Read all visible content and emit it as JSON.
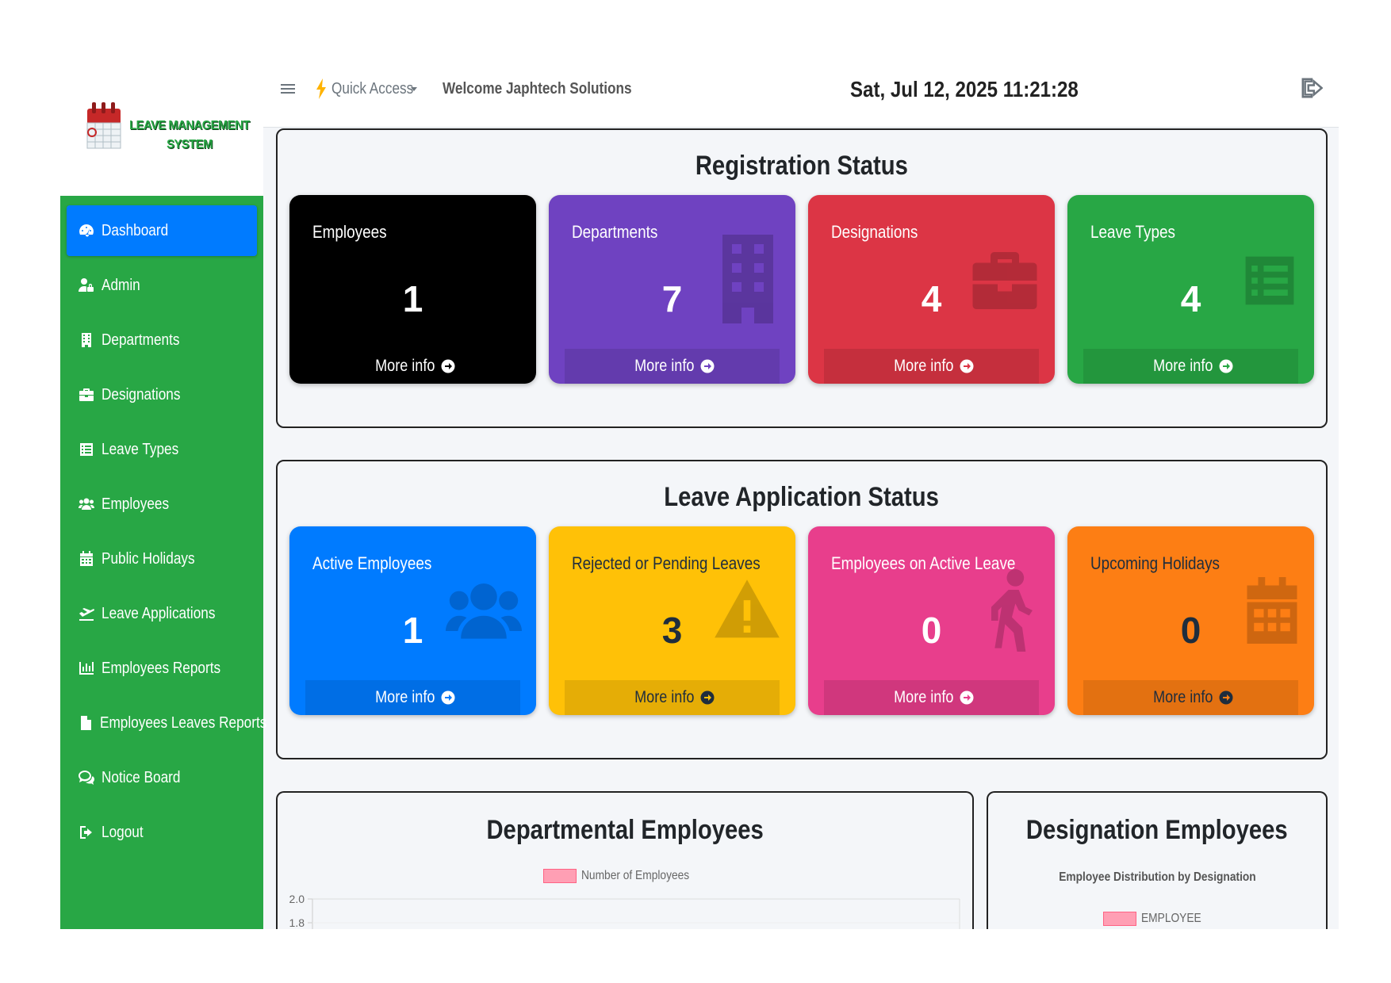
{
  "brand": {
    "line1": "LEAVE MANAGEMENT",
    "line2": "SYSTEM"
  },
  "sidebar": {
    "items": [
      {
        "label": "Dashboard",
        "icon": "tachometer-icon",
        "active": true
      },
      {
        "label": "Admin",
        "icon": "user-lock-icon"
      },
      {
        "label": "Departments",
        "icon": "building-icon"
      },
      {
        "label": "Designations",
        "icon": "briefcase-icon"
      },
      {
        "label": "Leave Types",
        "icon": "list-icon"
      },
      {
        "label": "Employees",
        "icon": "users-icon"
      },
      {
        "label": "Public Holidays",
        "icon": "calendar-icon"
      },
      {
        "label": "Leave Applications",
        "icon": "plane-departure-icon"
      },
      {
        "label": "Employees Reports",
        "icon": "chart-bar-icon"
      },
      {
        "label": "Employees Leaves Reports",
        "icon": "file-icon"
      },
      {
        "label": "Notice Board",
        "icon": "comments-icon"
      },
      {
        "label": "Logout",
        "icon": "sign-out-icon"
      }
    ]
  },
  "topbar": {
    "quick_access": "Quick Access",
    "welcome": "Welcome Japhtech Solutions",
    "datetime": "Sat, Jul 12, 2025 11:21:28"
  },
  "registration": {
    "title": "Registration Status",
    "boxes": [
      {
        "label": "Employees",
        "value": "1",
        "footer": "More info",
        "color": "#000000"
      },
      {
        "label": "Departments",
        "value": "7",
        "footer": "More info",
        "color": "#6f42c1",
        "icon": "building-icon"
      },
      {
        "label": "Designations",
        "value": "4",
        "footer": "More info",
        "color": "#dc3545",
        "icon": "briefcase-icon"
      },
      {
        "label": "Leave Types",
        "value": "4",
        "footer": "More info",
        "color": "#28a745",
        "icon": "list-icon"
      }
    ]
  },
  "leave_status": {
    "title": "Leave Application Status",
    "boxes": [
      {
        "label": "Active Employees",
        "value": "1",
        "footer": "More info",
        "color": "#007bff",
        "icon": "users-icon"
      },
      {
        "label": "Rejected or Pending Leaves",
        "value": "3",
        "footer": "More info",
        "color": "#ffc107",
        "icon": "warning-icon"
      },
      {
        "label": "Employees on Active Leave",
        "value": "0",
        "footer": "More info",
        "color": "#e83e8c",
        "icon": "walking-icon"
      },
      {
        "label": "Upcoming Holidays",
        "value": "0",
        "footer": "More info",
        "color": "#fd7e14",
        "icon": "calendar-icon"
      }
    ]
  },
  "dept_chart": {
    "title": "Departmental Employees",
    "legend": "Number of Employees",
    "chart_data": {
      "type": "bar",
      "title": "Departmental Employees",
      "legend": [
        "Number of Employees"
      ],
      "visible_y_ticks": [
        "2.0",
        "1.8"
      ],
      "ylim": [
        0,
        2.0
      ]
    }
  },
  "desig_chart": {
    "title": "Designation Employees",
    "subtitle": "Employee Distribution by Designation",
    "legend": "EMPLOYEE"
  }
}
